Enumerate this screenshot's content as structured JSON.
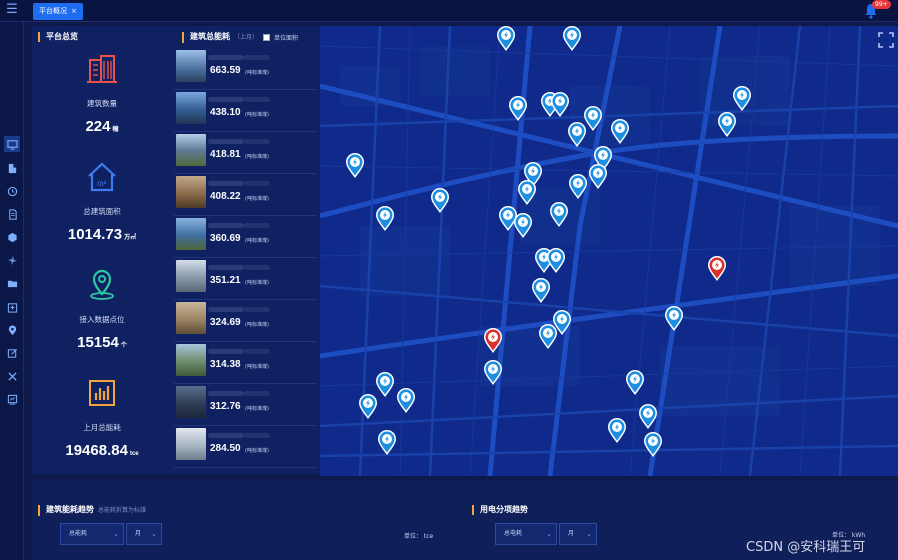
{
  "topbar": {
    "menu_glyph": "☰",
    "tab_label": "平台概况",
    "tab_close": "×",
    "notification_badge": "99+"
  },
  "overview": {
    "title": "平台总览",
    "stats": [
      {
        "label": "建筑数量",
        "value": "224",
        "unit": "幢",
        "icon": "building-icon"
      },
      {
        "label": "总建筑面积",
        "value": "1014.73",
        "unit": "万㎡",
        "icon": "house-area-icon"
      },
      {
        "label": "接入数据点位",
        "value": "15154",
        "unit": "个",
        "icon": "location-pin-icon"
      },
      {
        "label": "上月总能耗",
        "value": "19468.84",
        "unit": "tce",
        "icon": "bar-chart-icon"
      }
    ]
  },
  "energy": {
    "title": "建筑总能耗",
    "subtitle": "（上月）",
    "checkbox_label": "单位面积",
    "unit_label": "(吨标准煤)",
    "buildings": [
      {
        "value": "663.59"
      },
      {
        "value": "438.10"
      },
      {
        "value": "418.81"
      },
      {
        "value": "408.22"
      },
      {
        "value": "360.69"
      },
      {
        "value": "351.21"
      },
      {
        "value": "324.69"
      },
      {
        "value": "314.38"
      },
      {
        "value": "312.76"
      },
      {
        "value": "284.50"
      }
    ]
  },
  "trend": {
    "title": "建筑能耗趋势",
    "subtitle": "总能耗折算为标煤",
    "select1": "总能耗",
    "select2": "月",
    "unit": "单位：  tce"
  },
  "split": {
    "title": "用电分项趋势",
    "select1": "总电耗",
    "select2": "月",
    "unit": "单位：  kWh"
  },
  "watermark": "CSDN @安科瑞王可",
  "colors": {
    "accent": "#1e6cf0",
    "highlight": "#f0a43a",
    "pin_blue": "#1d8fe0",
    "pin_red": "#d8322f"
  }
}
